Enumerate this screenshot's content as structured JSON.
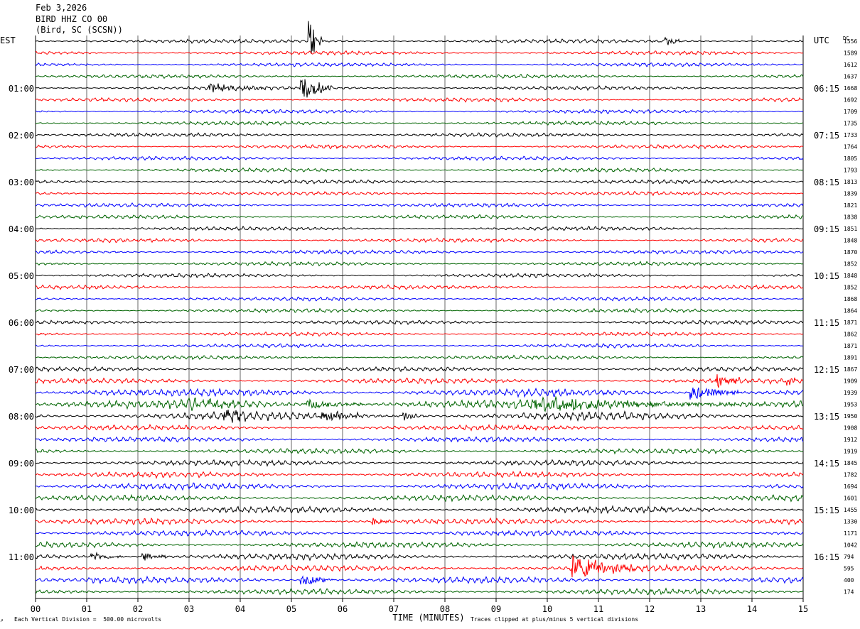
{
  "header": {
    "date": "Feb 3,2026",
    "station": "BIRD HHZ CO 00",
    "location": "(Bird, SC (SCSN))"
  },
  "left_zone": "EST",
  "right_zone": "UTC",
  "dc_label": "DC",
  "footer": {
    "scale_note": "Each Vertical Division =  500.00 microvolts",
    "clip_note": "Traces clipped at plus/minus 5 vertical divisions",
    "corner_mark": "↗"
  },
  "colors": {
    "trace_cycle": [
      "#000000",
      "#ff0000",
      "#0000ff",
      "#006400"
    ],
    "grid": "#000000",
    "background": "#ffffff"
  },
  "chart_data": {
    "type": "helicorder",
    "title": "BIRD HHZ CO 00",
    "xlabel": "TIME (MINUTES)",
    "x_ticks": [
      "00",
      "01",
      "02",
      "03",
      "04",
      "05",
      "06",
      "07",
      "08",
      "09",
      "10",
      "11",
      "12",
      "13",
      "14",
      "15"
    ],
    "xlim": [
      0,
      15
    ],
    "left_labels": [
      {
        "row": 4,
        "label": "01:00"
      },
      {
        "row": 8,
        "label": "02:00"
      },
      {
        "row": 12,
        "label": "03:00"
      },
      {
        "row": 16,
        "label": "04:00"
      },
      {
        "row": 20,
        "label": "05:00"
      },
      {
        "row": 24,
        "label": "06:00"
      },
      {
        "row": 28,
        "label": "07:00"
      },
      {
        "row": 32,
        "label": "08:00"
      },
      {
        "row": 36,
        "label": "09:00"
      },
      {
        "row": 40,
        "label": "10:00"
      },
      {
        "row": 44,
        "label": "11:00"
      }
    ],
    "right_labels": [
      {
        "row": 4,
        "label": "06:15"
      },
      {
        "row": 8,
        "label": "07:15"
      },
      {
        "row": 12,
        "label": "08:15"
      },
      {
        "row": 16,
        "label": "09:15"
      },
      {
        "row": 20,
        "label": "10:15"
      },
      {
        "row": 24,
        "label": "11:15"
      },
      {
        "row": 28,
        "label": "12:15"
      },
      {
        "row": 32,
        "label": "13:15"
      },
      {
        "row": 36,
        "label": "14:15"
      },
      {
        "row": 40,
        "label": "15:15"
      },
      {
        "row": 44,
        "label": "16:15"
      }
    ],
    "dc_offsets": [
      "1556",
      "1589",
      "1612",
      "1637",
      "1668",
      "1692",
      "1709",
      "1735",
      "1733",
      "1764",
      "1805",
      "1793",
      "1813",
      "1839",
      "1821",
      "1838",
      "1851",
      "1848",
      "1870",
      "1852",
      "1848",
      "1852",
      "1868",
      "1864",
      "1871",
      "1862",
      "1871",
      "1891",
      "1867",
      "1909",
      "1939",
      "1953",
      "1950",
      "1908",
      "1912",
      "1919",
      "1845",
      "1782",
      "1694",
      "1601",
      "1455",
      "1330",
      "1171",
      "1042",
      "794",
      "595",
      "400",
      "174"
    ],
    "noise_level": [
      0.6,
      0.6,
      0.6,
      0.6,
      0.6,
      0.6,
      0.6,
      0.6,
      0.6,
      0.6,
      0.6,
      0.6,
      0.6,
      0.6,
      0.6,
      0.6,
      0.6,
      0.6,
      0.6,
      0.6,
      0.6,
      0.6,
      0.6,
      0.6,
      0.6,
      0.6,
      0.6,
      0.6,
      0.7,
      0.8,
      1.2,
      1.4,
      1.3,
      0.8,
      0.8,
      0.8,
      0.9,
      0.9,
      1.0,
      0.9,
      1.0,
      0.9,
      0.9,
      0.9,
      1.0,
      1.0,
      1.0,
      0.9
    ],
    "events": [
      {
        "row": 0,
        "minute": 5.35,
        "duration": 0.25,
        "amplitude": 9
      },
      {
        "row": 0,
        "minute": 12.3,
        "duration": 0.3,
        "amplitude": 2
      },
      {
        "row": 4,
        "minute": 3.4,
        "duration": 1.1,
        "amplitude": 1.6
      },
      {
        "row": 4,
        "minute": 5.2,
        "duration": 0.6,
        "amplitude": 5
      },
      {
        "row": 29,
        "minute": 13.3,
        "duration": 0.5,
        "amplitude": 3
      },
      {
        "row": 29,
        "minute": 14.7,
        "duration": 0.2,
        "amplitude": 2
      },
      {
        "row": 30,
        "minute": 12.8,
        "duration": 1.0,
        "amplitude": 3
      },
      {
        "row": 31,
        "minute": 2.9,
        "duration": 1.5,
        "amplitude": 2.5
      },
      {
        "row": 31,
        "minute": 5.3,
        "duration": 1.1,
        "amplitude": 2.2
      },
      {
        "row": 31,
        "minute": 9.7,
        "duration": 4.6,
        "amplitude": 2.3
      },
      {
        "row": 32,
        "minute": 3.7,
        "duration": 0.6,
        "amplitude": 2.5
      },
      {
        "row": 32,
        "minute": 5.6,
        "duration": 0.7,
        "amplitude": 2.5
      },
      {
        "row": 32,
        "minute": 7.2,
        "duration": 0.4,
        "amplitude": 2
      },
      {
        "row": 41,
        "minute": 6.6,
        "duration": 0.3,
        "amplitude": 1.5
      },
      {
        "row": 44,
        "minute": 1.1,
        "duration": 0.6,
        "amplitude": 1.7
      },
      {
        "row": 44,
        "minute": 2.1,
        "duration": 0.5,
        "amplitude": 1.7
      },
      {
        "row": 45,
        "minute": 10.5,
        "duration": 1.2,
        "amplitude": 5
      },
      {
        "row": 46,
        "minute": 5.2,
        "duration": 0.6,
        "amplitude": 2.5
      }
    ]
  }
}
